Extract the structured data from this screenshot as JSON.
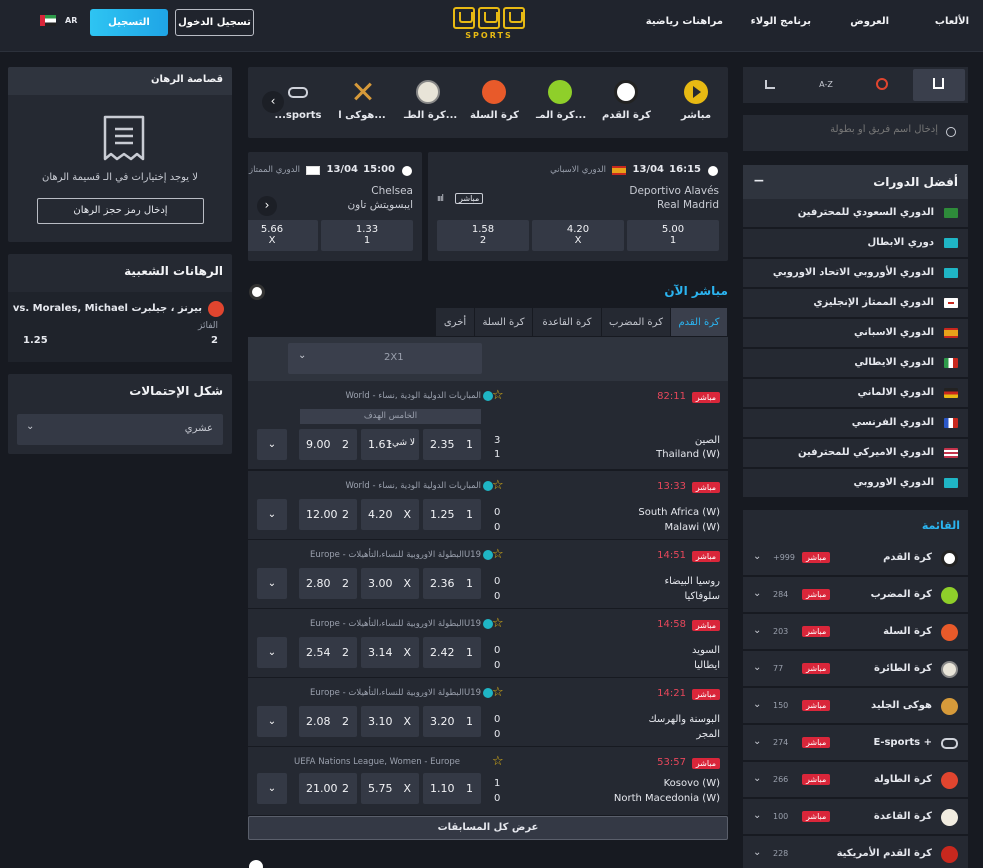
{
  "header": {
    "nav": [
      "الألعاب",
      "العروض",
      "برنامج الولاء",
      "مراهنات رياضية"
    ],
    "register": "التسجيل",
    "login": "تسجيل الدخول",
    "lang": "AR",
    "logo_text": "SPORTS"
  },
  "left": {
    "betslip_title": "قصاصة الرهان",
    "betslip_empty": "لا يوجد إختيارات في الـ قسيمة الرهان",
    "betslip_code_btn": "إدخال رمز حجز الرهان",
    "popular_title": "الرهانات الشعبية",
    "popular_match": "vs. Morales, Michael بيرنز ، جيلبرت",
    "popular_market": "الفائز",
    "popular_pick": "2",
    "popular_odd": "1.25",
    "odds_format_title": "شكل الإحتمالات",
    "odds_format_value": "عشري"
  },
  "right": {
    "tab_az": "A-Z",
    "search_placeholder": "إدخال اسم فريق أو بطولة",
    "top_leagues_title": "أفضل الدورات",
    "top_leagues_toggle": "−",
    "leagues": [
      {
        "name": "الدوري السعودي للمحترفين",
        "flag": "#2e8b3a"
      },
      {
        "name": "دوري الابطال",
        "flag": "#1fb5c5"
      },
      {
        "name": "الدوري الأوروبي الاتحاد الاوروبي",
        "flag": "#1fb5c5"
      },
      {
        "name": "الدوري الممتاز الإنجليزي",
        "flag": "#ffffff"
      },
      {
        "name": "الدوري الاسباني",
        "flag": "#e7a21a"
      },
      {
        "name": "الدوري الايطالي",
        "flag": "#2e9a4a"
      },
      {
        "name": "الدوري الالماني",
        "flag": "#c8281e"
      },
      {
        "name": "الدوري الفرنسي",
        "flag": "#2b57c8"
      },
      {
        "name": "الدوري الاميركي للمحترفين",
        "flag": "#c3344c"
      },
      {
        "name": "الدوري الاوروبي",
        "flag": "#1fb5c5"
      }
    ],
    "menu_title": "القائمة",
    "categories": [
      {
        "name": "كرة القدم",
        "count": "+999",
        "live": "مباشر",
        "icon": "#ffffff"
      },
      {
        "name": "كرة المضرب",
        "count": "284",
        "live": "مباشر",
        "icon": "#8fcf2a"
      },
      {
        "name": "كرة السلة",
        "count": "203",
        "live": "مباشر",
        "icon": "#e85a2a"
      },
      {
        "name": "كرة الطائرة",
        "count": "77",
        "live": "مباشر",
        "icon": "#e8e4d8"
      },
      {
        "name": "هوكى الجليد",
        "count": "150",
        "live": "مباشر",
        "icon": "#d69a3a"
      },
      {
        "name": "E-sports +",
        "count": "274",
        "live": "مباشر",
        "icon": "#cfd2da"
      },
      {
        "name": "كرة الطاولة",
        "count": "266",
        "live": "مباشر",
        "icon": "#e0452f"
      },
      {
        "name": "كرة القاعدة",
        "count": "100",
        "live": "مباشر",
        "icon": "#f1ece0"
      },
      {
        "name": "كرة القدم الأمريكية",
        "count": "228",
        "live": "",
        "icon": "#c8281e"
      }
    ]
  },
  "center": {
    "sports": [
      {
        "name": "مباشر",
        "color": "#e7b913"
      },
      {
        "name": "كرة القدم",
        "color": "#ffffff"
      },
      {
        "name": "كرة المـ...",
        "color": "#8fcf2a"
      },
      {
        "name": "كرة السلة",
        "color": "#e85a2a"
      },
      {
        "name": "كرة الطـ...",
        "color": "#e8e4d8"
      },
      {
        "name": "هوكى ا...",
        "color": "#d69a3a"
      },
      {
        "name": "...sports",
        "color": "#cfd2da"
      }
    ],
    "featured": [
      {
        "time": "16:15",
        "date": "13/04",
        "league": "الدوري الاسباني",
        "home": "Deportivo Alavés",
        "away": "Real Madrid",
        "live": "مباشر",
        "odds": [
          {
            "v": "5.00",
            "k": "1"
          },
          {
            "v": "4.20",
            "k": "X"
          },
          {
            "v": "1.58",
            "k": "2"
          }
        ]
      },
      {
        "time": "15:00",
        "date": "13/04",
        "league": "الدوري الممتاز",
        "home": "Chelsea",
        "away": "ايبسويتش تاون",
        "odds": [
          {
            "v": "1.33",
            "k": "1"
          },
          {
            "v": "5.66",
            "k": "X"
          }
        ]
      }
    ],
    "live_title": "مباشر الآن",
    "tabs": [
      "كرة القدم",
      "كرة المضرب",
      "كرة القاعدة",
      "كرة السلة",
      "أخرى"
    ],
    "market_select": "2X1",
    "market_label": "الخامس الهدف",
    "matches": [
      {
        "time": "82:11",
        "comp": "المباريات الدولية الودية ,نساء - World",
        "home": "الصين",
        "away": "Thailand (W)",
        "s1": "3",
        "s2": "1",
        "odds": [
          {
            "k": "1",
            "v": "2.35"
          },
          {
            "k": "لا شيء",
            "v": "1.61"
          },
          {
            "k": "2",
            "v": "9.00"
          }
        ]
      },
      {
        "time": "13:33",
        "comp": "المباريات الدولية الودية ,نساء - World",
        "home": "South Africa (W)",
        "away": "Malawi (W)",
        "s1": "0",
        "s2": "0",
        "odds": [
          {
            "k": "1",
            "v": "1.25"
          },
          {
            "k": "X",
            "v": "4.20"
          },
          {
            "k": "2",
            "v": "12.00"
          }
        ]
      },
      {
        "time": "14:51",
        "comp": "U19البطولة الاوروبية للنساء،التأهيلات - Europe",
        "home": "روسيا البيضاء",
        "away": "سلوفاكيا",
        "s1": "0",
        "s2": "0",
        "odds": [
          {
            "k": "1",
            "v": "2.36"
          },
          {
            "k": "X",
            "v": "3.00"
          },
          {
            "k": "2",
            "v": "2.80"
          }
        ]
      },
      {
        "time": "14:58",
        "comp": "U19البطولة الاوروبية للنساء،التأهيلات - Europe",
        "home": "السويد",
        "away": "ايطاليا",
        "s1": "0",
        "s2": "0",
        "odds": [
          {
            "k": "1",
            "v": "2.42"
          },
          {
            "k": "X",
            "v": "3.14"
          },
          {
            "k": "2",
            "v": "2.54"
          }
        ]
      },
      {
        "time": "14:21",
        "comp": "U19البطولة الاوروبية للنساء،التأهيلات - Europe",
        "home": "البوسنة والهرسك",
        "away": "المجر",
        "s1": "0",
        "s2": "0",
        "odds": [
          {
            "k": "1",
            "v": "3.20"
          },
          {
            "k": "X",
            "v": "3.10"
          },
          {
            "k": "2",
            "v": "2.08"
          }
        ]
      },
      {
        "time": "53:57",
        "comp": "UEFA Nations League, Women - Europe",
        "home": "Kosovo (W)",
        "away": "North Macedonia (W)",
        "s1": "1",
        "s2": "0",
        "odds": [
          {
            "k": "1",
            "v": "1.10"
          },
          {
            "k": "X",
            "v": "5.75"
          },
          {
            "k": "2",
            "v": "21.00"
          }
        ]
      }
    ],
    "live_tag": "مباشر",
    "show_all": "عرض كل المسابقات"
  }
}
